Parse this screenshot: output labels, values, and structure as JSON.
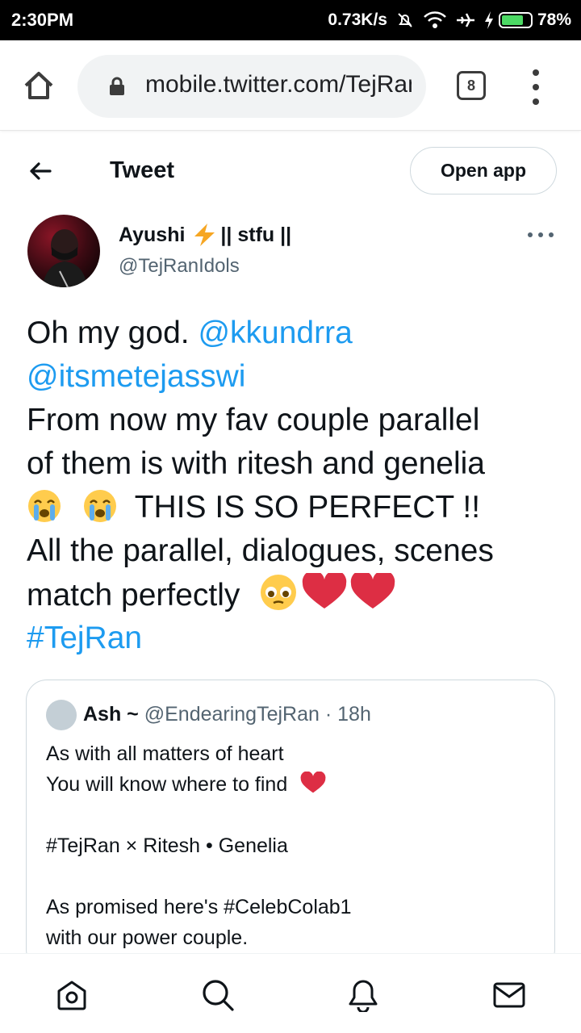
{
  "status_bar": {
    "time": "2:30PM",
    "speed": "0.73K/s",
    "battery": "78%",
    "battery_level": 0.78,
    "battery_color": "#4cd964"
  },
  "browser": {
    "url": "mobile.twitter.com/TejRanIdols/status",
    "tab_count": "8",
    "icons": [
      "home-icon",
      "lock-icon",
      "tabs-icon",
      "more-vertical-icon"
    ]
  },
  "header": {
    "title": "Tweet",
    "open_app_label": "Open app"
  },
  "author": {
    "name": "Ayushi",
    "name_suffix": "|| stfu ||",
    "handle": "@TejRanIdols"
  },
  "tweet": {
    "mention1": "@kkundrra",
    "mention2": "@itsmetejasswi",
    "line3": "From now my fav couple parallel",
    "line4": "of them is with ritesh and genelia",
    "line5_text": "THIS IS SO PERFECT !!",
    "line6": "All the parallel, dialogues, scenes",
    "line7_text": "match perfectly",
    "hashtag": "#TejRan",
    "link_color": "#1d9bf0"
  },
  "quoted": {
    "name": "Ash ~",
    "handle": "@EndearingTejRan",
    "time": "· 18h",
    "line1": "As with all matters of heart",
    "line2": "You will know where to find",
    "line3": "#TejRan × Ritesh • Genelia",
    "line4": "As promised here's #CelebColab1",
    "line5": "with our power couple."
  },
  "bottom_nav": [
    "home-icon",
    "search-icon",
    "notifications-icon",
    "messages-icon"
  ]
}
